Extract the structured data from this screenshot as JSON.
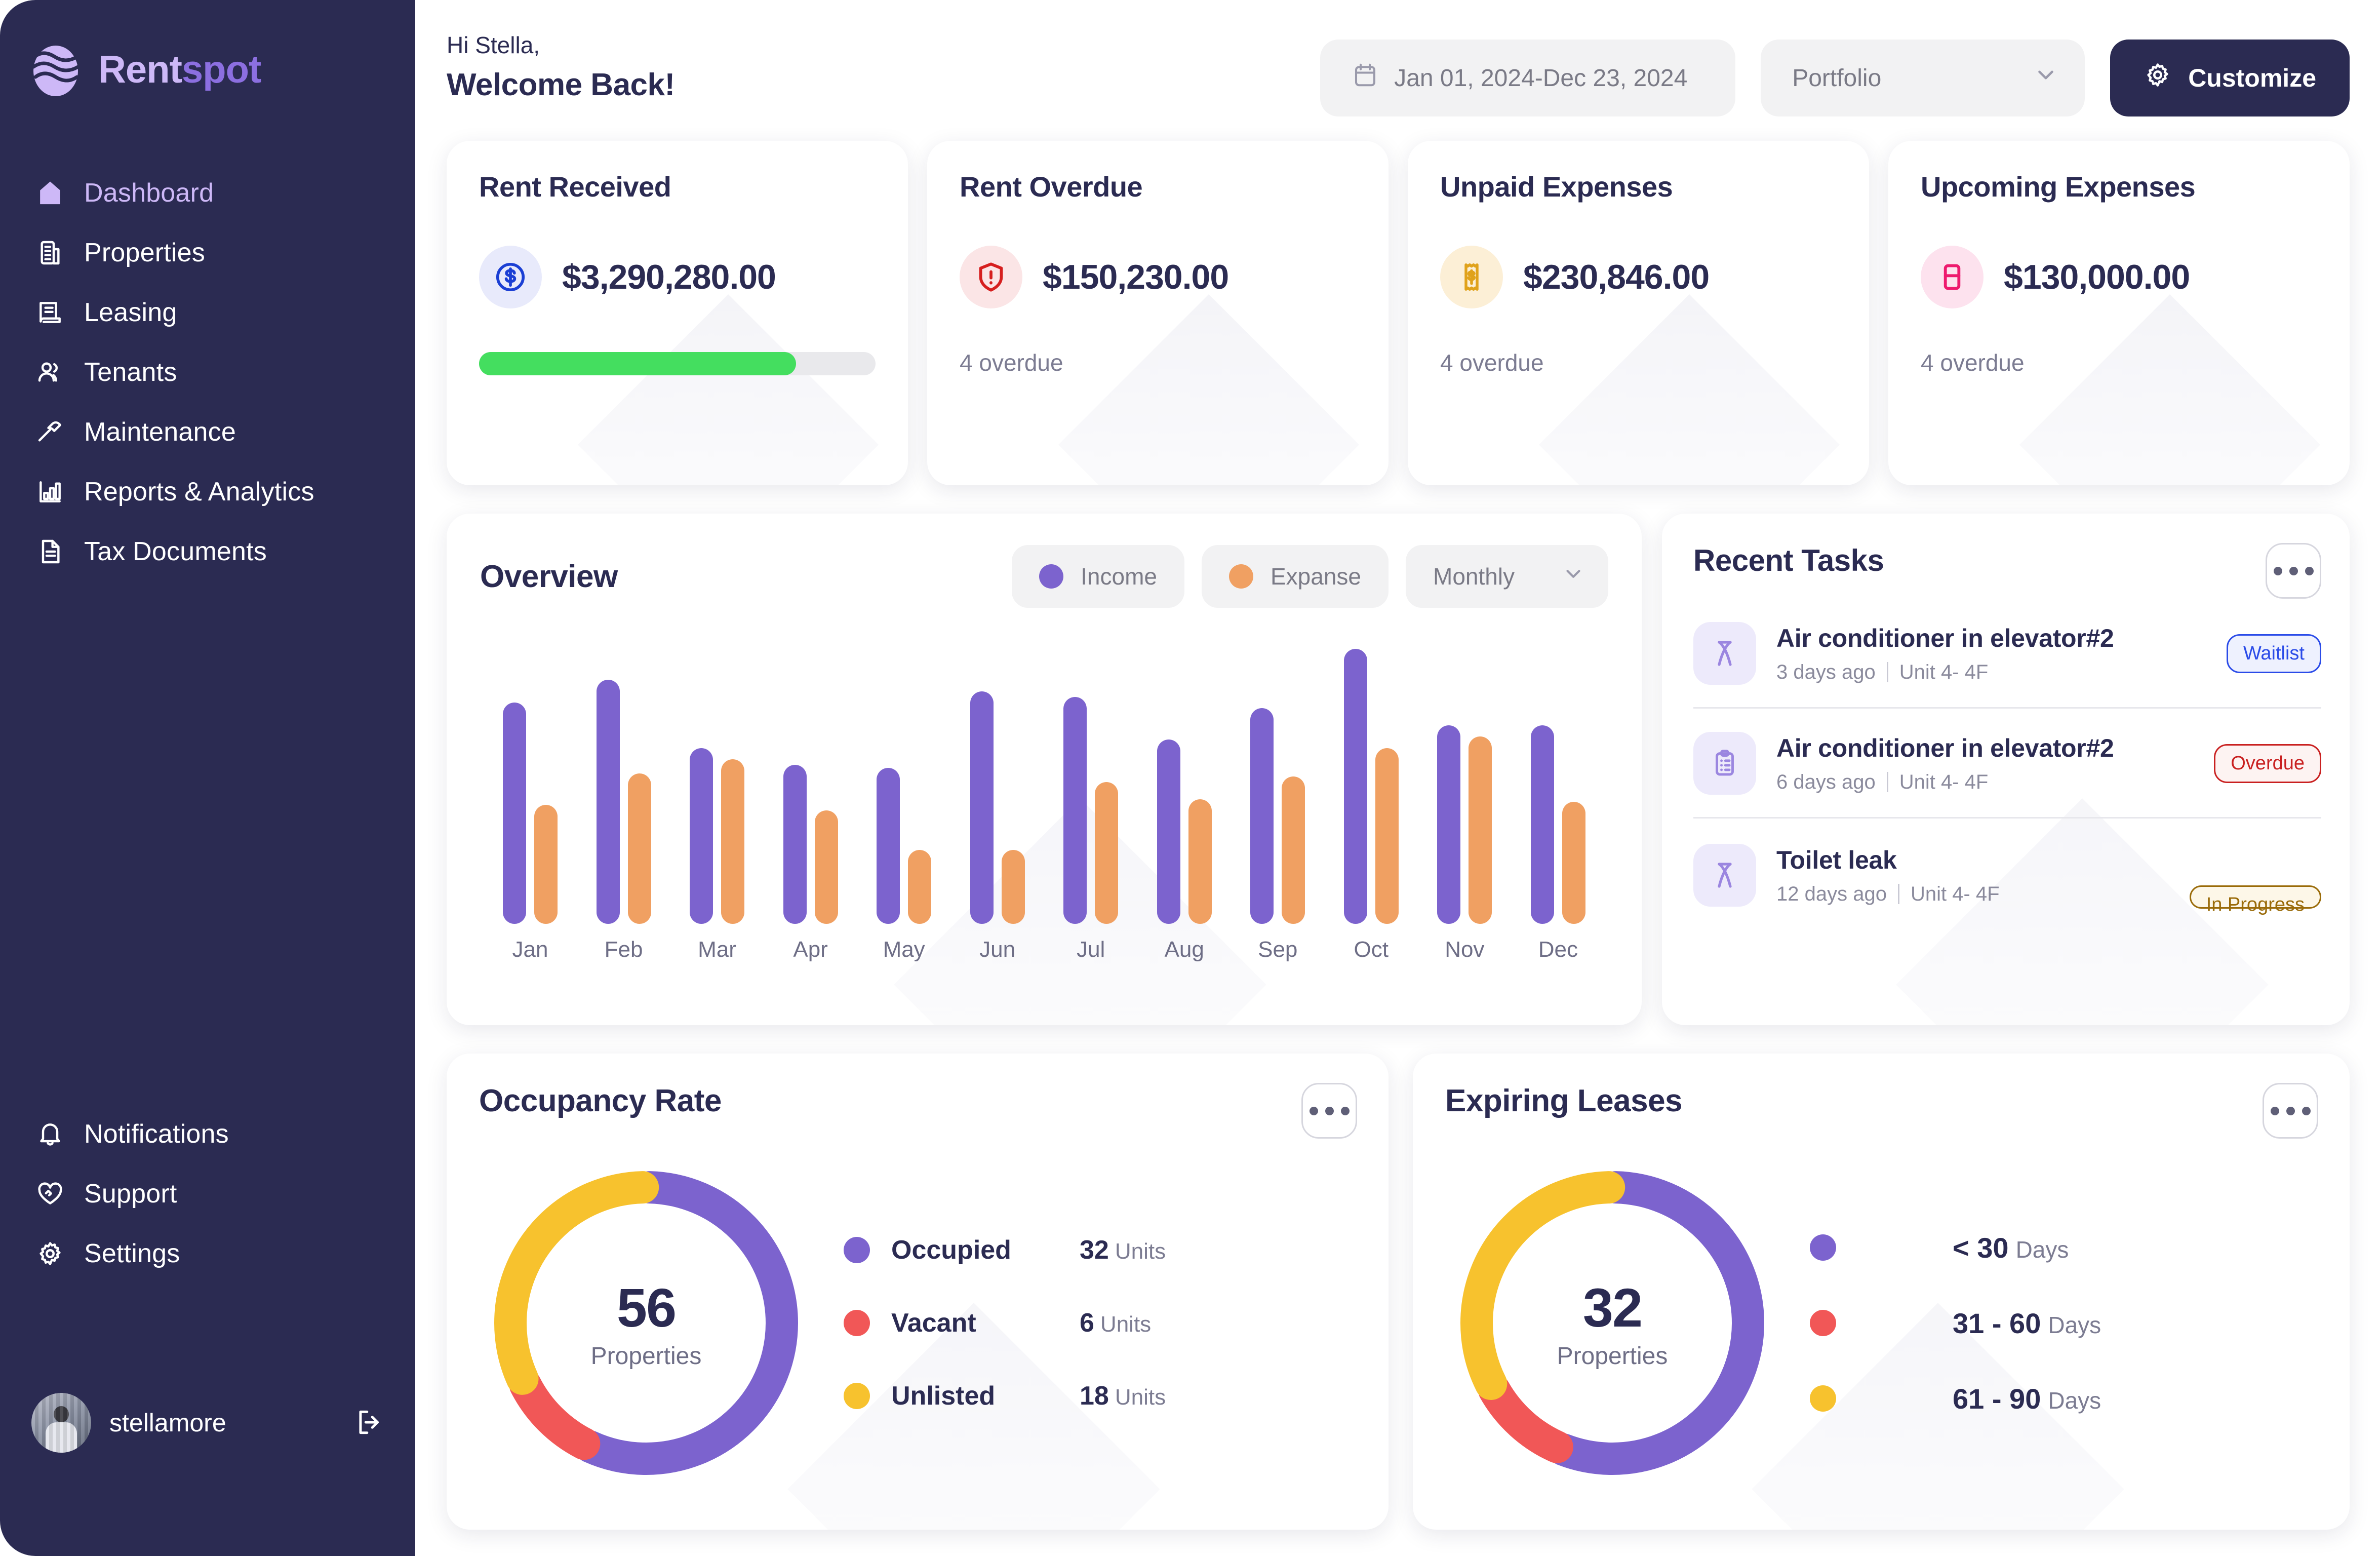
{
  "brand": {
    "name_part1": "Rent",
    "name_part2": "spot"
  },
  "sidebar": {
    "items": [
      {
        "label": "Dashboard",
        "icon": "home-icon",
        "active": true
      },
      {
        "label": "Properties",
        "icon": "building-icon",
        "active": false
      },
      {
        "label": "Leasing",
        "icon": "lease-document-icon",
        "active": false
      },
      {
        "label": "Tenants",
        "icon": "users-icon",
        "active": false
      },
      {
        "label": "Maintenance",
        "icon": "hammer-icon",
        "active": false
      },
      {
        "label": "Reports & Analytics",
        "icon": "bar-chart-icon",
        "active": false
      },
      {
        "label": "Tax Documents",
        "icon": "file-text-icon",
        "active": false
      }
    ],
    "bottom_items": [
      {
        "label": "Notifications",
        "icon": "bell-icon"
      },
      {
        "label": "Support",
        "icon": "heart-handshake-icon"
      },
      {
        "label": "Settings",
        "icon": "gear-icon"
      }
    ],
    "user": {
      "name": "stellamore",
      "logout_icon": "logout-icon"
    }
  },
  "header": {
    "greeting_small": "Hi Stella,",
    "greeting_big": "Welcome Back!",
    "date_range": "Jan 01, 2024-Dec 23, 2024",
    "date_icon": "calendar-icon",
    "portfolio_select": "Portfolio",
    "portfolio_chevron": "chevron-down-icon",
    "customize_label": "Customize",
    "customize_icon": "gear-icon"
  },
  "kpis": [
    {
      "title": "Rent Received",
      "value": "$3,290,280.00",
      "icon": "dollar-circle-icon",
      "icon_color": "#1B3FD4",
      "icon_bg": "#E8EAFB",
      "progress_percent": 80,
      "progress_color": "#44DE5F",
      "footer": ""
    },
    {
      "title": "Rent Overdue",
      "value": "$150,230.00",
      "icon": "shield-alert-icon",
      "icon_color": "#D61F1F",
      "icon_bg": "#FBE5E6",
      "footer": "4 overdue"
    },
    {
      "title": "Unpaid Expenses",
      "value": "$230,846.00",
      "icon": "receipt-dollar-icon",
      "icon_color": "#E0A21B",
      "icon_bg": "#FCEFD6",
      "footer": "4 overdue"
    },
    {
      "title": "Upcoming Expenses",
      "value": "$130,000.00",
      "icon": "credit-card-icon",
      "icon_color": "#EE1A6E",
      "icon_bg": "#FDE2EE",
      "footer": "4 overdue"
    }
  ],
  "overview": {
    "title": "Overview",
    "legend_income": "Income",
    "legend_expense": "Expanse",
    "period_select": "Monthly",
    "period_chevron": "chevron-down-icon",
    "income_color": "#7C63CE",
    "expense_color": "#F0A062"
  },
  "chart_data": {
    "type": "bar",
    "title": "Overview",
    "categories": [
      "Jan",
      "Feb",
      "Mar",
      "Apr",
      "May",
      "Jun",
      "Jul",
      "Aug",
      "Sep",
      "Oct",
      "Nov",
      "Dec"
    ],
    "series": [
      {
        "name": "Income",
        "color": "#7C63CE",
        "values": [
          78,
          86,
          62,
          56,
          55,
          82,
          80,
          65,
          76,
          97,
          70,
          70
        ]
      },
      {
        "name": "Expanse",
        "color": "#F0A062",
        "values": [
          42,
          53,
          58,
          40,
          26,
          26,
          50,
          44,
          52,
          62,
          66,
          43
        ]
      }
    ],
    "xlabel": "",
    "ylabel": "",
    "ylim": [
      0,
      100
    ],
    "grid": false,
    "legend_position": "top-right"
  },
  "tasks": {
    "title": "Recent Tasks",
    "menu_icon": "more-horizontal-icon",
    "items": [
      {
        "icon": "hammer-icon",
        "name": "Air conditioner in elevator#2",
        "time": "3 days ago",
        "unit": "Unit 4- 4F",
        "status": "Waitlist",
        "status_type": "waitlist"
      },
      {
        "icon": "clipboard-list-icon",
        "name": "Air conditioner in elevator#2",
        "time": "6 days ago",
        "unit": "Unit 4- 4F",
        "status": "Overdue",
        "status_type": "overdue"
      },
      {
        "icon": "hammer-icon",
        "name": "Toilet leak",
        "time": "12 days ago",
        "unit": "Unit 4- 4F",
        "status": "In Progress",
        "status_type": "progress"
      }
    ]
  },
  "occupancy": {
    "title": "Occupancy Rate",
    "menu_icon": "more-horizontal-icon",
    "center_value": "56",
    "center_label": "Properties",
    "legend": [
      {
        "label": "Occupied",
        "value": "32",
        "unit": "Units",
        "color": "#7C63CE"
      },
      {
        "label": "Vacant",
        "value": "6",
        "unit": "Units",
        "color": "#F15757"
      },
      {
        "label": "Unlisted",
        "value": "18",
        "unit": "Units",
        "color": "#F7C22E"
      }
    ]
  },
  "leases": {
    "title": "Expiring Leases",
    "menu_icon": "more-horizontal-icon",
    "center_value": "32",
    "center_label": "Properties",
    "legend": [
      {
        "label": "< 30",
        "unit": "Days",
        "color": "#7C63CE"
      },
      {
        "label": "31 - 60",
        "unit": "Days",
        "color": "#F15757"
      },
      {
        "label": "61 - 90",
        "unit": "Days",
        "color": "#F7C22E"
      }
    ]
  },
  "donut_chart_data": {
    "type": "pie",
    "charts": [
      {
        "title": "Occupancy Rate",
        "total": 56,
        "labels": [
          "Occupied",
          "Vacant",
          "Unlisted"
        ],
        "values": [
          32,
          6,
          18
        ],
        "colors": [
          "#7C63CE",
          "#F15757",
          "#F7C22E"
        ]
      },
      {
        "title": "Expiring Leases",
        "total": 32,
        "labels": [
          "< 30 Days",
          "31 - 60 Days",
          "61 - 90 Days"
        ],
        "values": [
          18,
          3.5,
          10.5
        ],
        "colors": [
          "#7C63CE",
          "#F15757",
          "#F7C22E"
        ]
      }
    ]
  }
}
